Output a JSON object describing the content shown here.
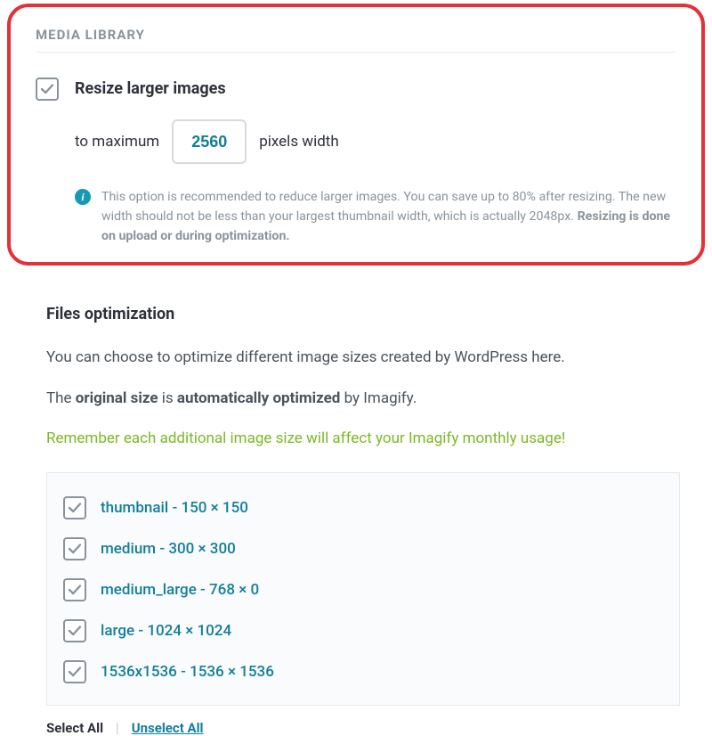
{
  "section_title": "MEDIA LIBRARY",
  "resize": {
    "title": "Resize larger images",
    "prefix": "to maximum",
    "value": "2560",
    "suffix": "pixels width",
    "hint_a": "This option is recommended to reduce larger images. You can save up to 80% after resizing. The new width should not be less than your largest thumbnail width, which is actually 2048px. ",
    "hint_b": "Resizing is done on upload or during optimization."
  },
  "files": {
    "heading": "Files optimization",
    "intro": "You can choose to optimize different image sizes created by WordPress here.",
    "line2_a": "The ",
    "line2_b": "original size",
    "line2_c": " is ",
    "line2_d": "automatically optimized",
    "line2_e": " by Imagify.",
    "warn": "Remember each additional image size will affect your Imagify monthly usage!",
    "sizes": [
      {
        "label": "thumbnail - 150 × 150"
      },
      {
        "label": "medium - 300 × 300"
      },
      {
        "label": "medium_large - 768 × 0"
      },
      {
        "label": "large - 1024 × 1024"
      },
      {
        "label": "1536x1536 - 1536 × 1536"
      }
    ],
    "select_all": "Select All",
    "unselect_all": "Unselect All"
  }
}
